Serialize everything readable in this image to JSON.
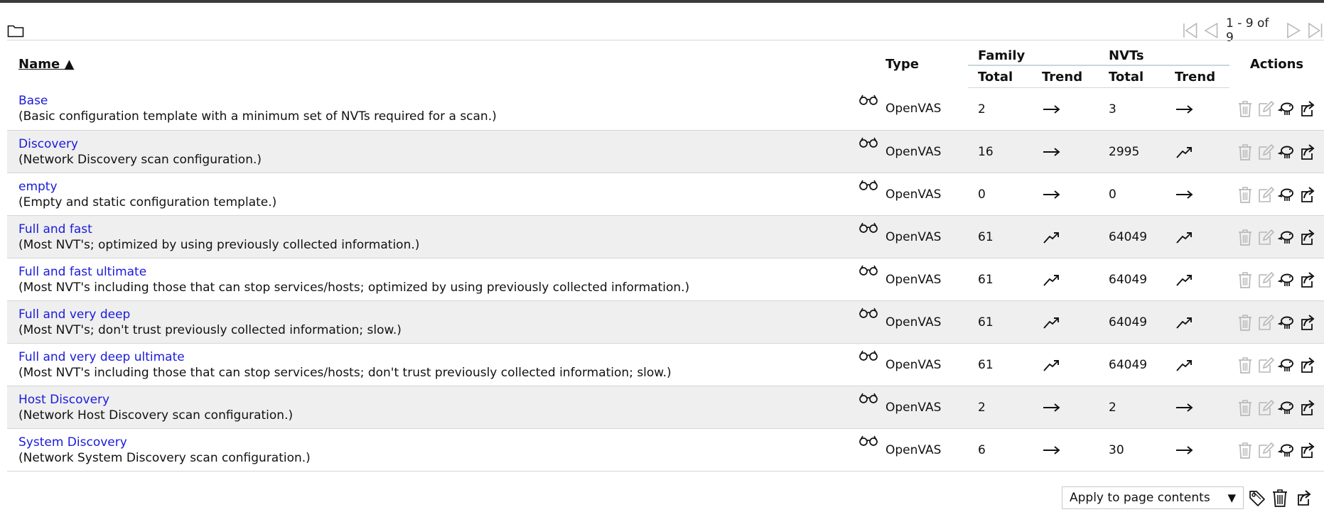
{
  "pagination": {
    "range_text": "1 - 9 of 9"
  },
  "columns": {
    "name": "Name ▲",
    "type": "Type",
    "family": "Family",
    "nvts": "NVTs",
    "total": "Total",
    "trend": "Trend",
    "actions": "Actions"
  },
  "rows": [
    {
      "name": "Base",
      "description": "(Basic configuration template with a minimum set of NVTs required for a scan.)",
      "type": "OpenVAS",
      "family_total": "2",
      "family_trend": "steady",
      "nvts_total": "3",
      "nvts_trend": "steady"
    },
    {
      "name": "Discovery",
      "description": "(Network Discovery scan configuration.)",
      "type": "OpenVAS",
      "family_total": "16",
      "family_trend": "steady",
      "nvts_total": "2995",
      "nvts_trend": "up"
    },
    {
      "name": "empty",
      "description": "(Empty and static configuration template.)",
      "type": "OpenVAS",
      "family_total": "0",
      "family_trend": "steady",
      "nvts_total": "0",
      "nvts_trend": "steady"
    },
    {
      "name": "Full and fast",
      "description": "(Most NVT's; optimized by using previously collected information.)",
      "type": "OpenVAS",
      "family_total": "61",
      "family_trend": "up",
      "nvts_total": "64049",
      "nvts_trend": "up"
    },
    {
      "name": "Full and fast ultimate",
      "description": "(Most NVT's including those that can stop services/hosts; optimized by using previously collected information.)",
      "type": "OpenVAS",
      "family_total": "61",
      "family_trend": "up",
      "nvts_total": "64049",
      "nvts_trend": "up"
    },
    {
      "name": "Full and very deep",
      "description": "(Most NVT's; don't trust previously collected information; slow.)",
      "type": "OpenVAS",
      "family_total": "61",
      "family_trend": "up",
      "nvts_total": "64049",
      "nvts_trend": "up"
    },
    {
      "name": "Full and very deep ultimate",
      "description": "(Most NVT's including those that can stop services/hosts; don't trust previously collected information; slow.)",
      "type": "OpenVAS",
      "family_total": "61",
      "family_trend": "up",
      "nvts_total": "64049",
      "nvts_trend": "up"
    },
    {
      "name": "Host Discovery",
      "description": "(Network Host Discovery scan configuration.)",
      "type": "OpenVAS",
      "family_total": "2",
      "family_trend": "steady",
      "nvts_total": "2",
      "nvts_trend": "steady"
    },
    {
      "name": "System Discovery",
      "description": "(Network System Discovery scan configuration.)",
      "type": "OpenVAS",
      "family_total": "6",
      "family_trend": "steady",
      "nvts_total": "30",
      "nvts_trend": "steady"
    }
  ],
  "bulk": {
    "apply_label": "Apply to page contents"
  },
  "colors": {
    "link": "#1a1adb",
    "alt_row": "#efefef",
    "top_bar": "#3a3a3a",
    "disabled_icon": "#b8b8b8"
  }
}
